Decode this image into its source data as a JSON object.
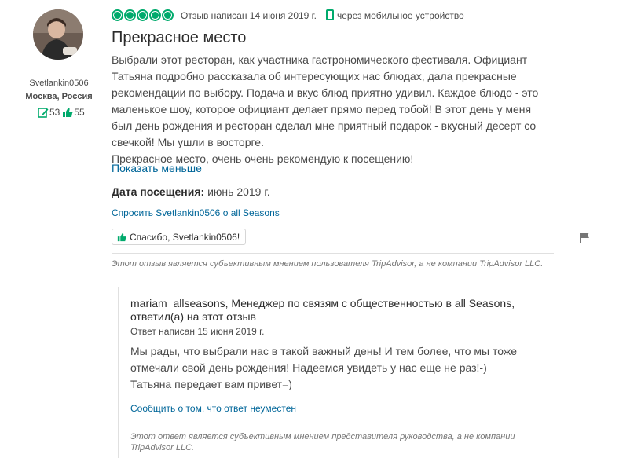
{
  "reviewer": {
    "username": "Svetlankin0506",
    "location": "Москва, Россия",
    "contributions": "53",
    "helpful_votes": "55"
  },
  "review": {
    "rating": 5,
    "written_date": "Отзыв написан 14 июня 2019 г.",
    "mobile_note": "через мобильное устройство",
    "title": "Прекрасное место",
    "body_lines": [
      "Выбрали этот ресторан, как участника гастрономического фестиваля. Официант",
      "Татьяна подробно рассказала об интересующих нас блюдах, дала прекрасные",
      "рекомендации по выбору. Подача и вкус блюд приятно удивил. Каждое блюдо - это",
      "маленькое шоу, которое официант делает прямо перед тобой! В этот день у меня",
      "был день рождения и ресторан сделал мне приятный подарок - вкусный десерт со",
      "свечкой! Мы ушли в восторге.",
      "Прекрасное место, очень очень рекомендую к посещению!"
    ],
    "show_less": "Показать меньше",
    "visit_label": "Дата посещения:",
    "visit_value": "июнь 2019 г.",
    "ask_link": "Спросить Svetlankin0506 о all Seasons",
    "thanks_button": "Спасибо, Svetlankin0506!",
    "disclaimer": "Этот отзыв является субъективным мнением пользователя TripAdvisor, а не компании TripAdvisor LLC."
  },
  "response": {
    "author_line": "mariam_allseasons, Менеджер по связям с общественностью в all Seasons, ответил(а) на этот отзыв",
    "date": "Ответ написан 15 июня 2019 г.",
    "body_lines": [
      "Мы рады, что выбрали нас в такой важный день! И тем более, что мы тоже",
      "отмечали свой день рождения! Надеемся увидеть у нас еще не раз!-)",
      "Татьяна передает вам привет=)"
    ],
    "report_link": "Сообщить о том, что ответ неуместен",
    "disclaimer": "Этот ответ является субъективным мнением представителя руководства, а не компании TripAdvisor LLC."
  },
  "colors": {
    "brand_green": "#00aa6c",
    "link_blue": "#006699",
    "text": "#4a4a4a"
  },
  "icons": {
    "rating": "bubble-rating-icon",
    "mobile": "mobile-phone-icon",
    "contributions": "pencil-review-icon",
    "helpful": "thumbs-up-icon",
    "flag": "flag-icon"
  }
}
